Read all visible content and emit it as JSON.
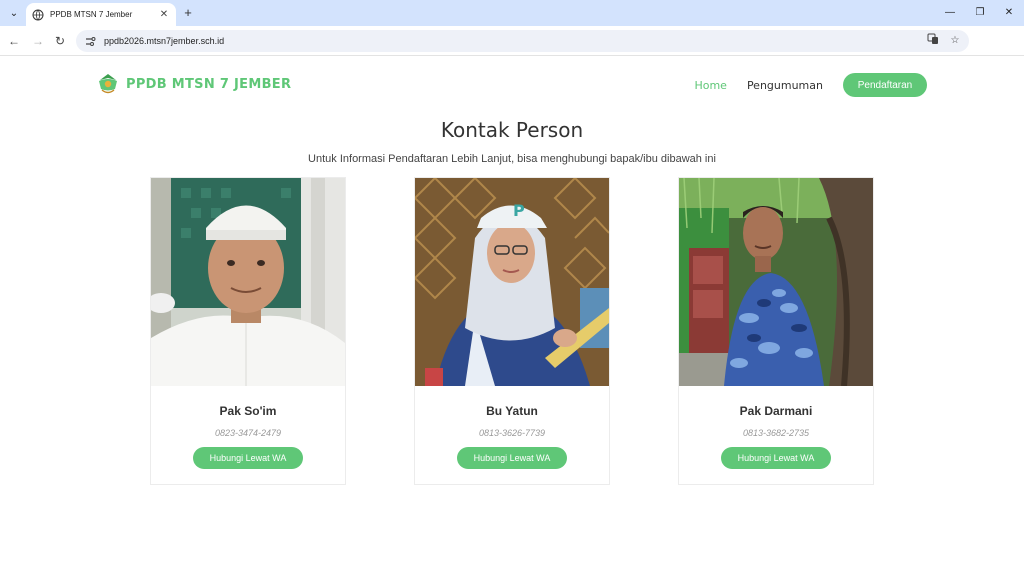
{
  "browser": {
    "tab_title": "PPDB MTSN 7 Jember",
    "url": "ppdb2026.mtsn7jember.sch.id"
  },
  "header": {
    "brand": "PPDB MTSN 7 JEMBER",
    "nav": [
      "Home",
      "Pengumuman"
    ],
    "cta": "Pendaftaran"
  },
  "main": {
    "title": "Kontak Person",
    "subtitle": "Untuk Informasi Pendaftaran Lebih Lanjut, bisa menghubungi bapak/ibu dibawah ini",
    "contacts": [
      {
        "name": "Pak So'im",
        "phone": "0823-3474-2479",
        "button": "Hubungi Lewat WA"
      },
      {
        "name": "Bu Yatun",
        "phone": "0813-3626-7739",
        "button": "Hubungi Lewat WA"
      },
      {
        "name": "Pak Darmani",
        "phone": "0813-3682-2735",
        "button": "Hubungi Lewat WA"
      }
    ]
  },
  "colors": {
    "accent": "#5fc777",
    "tabbar": "#d3e3fd"
  }
}
